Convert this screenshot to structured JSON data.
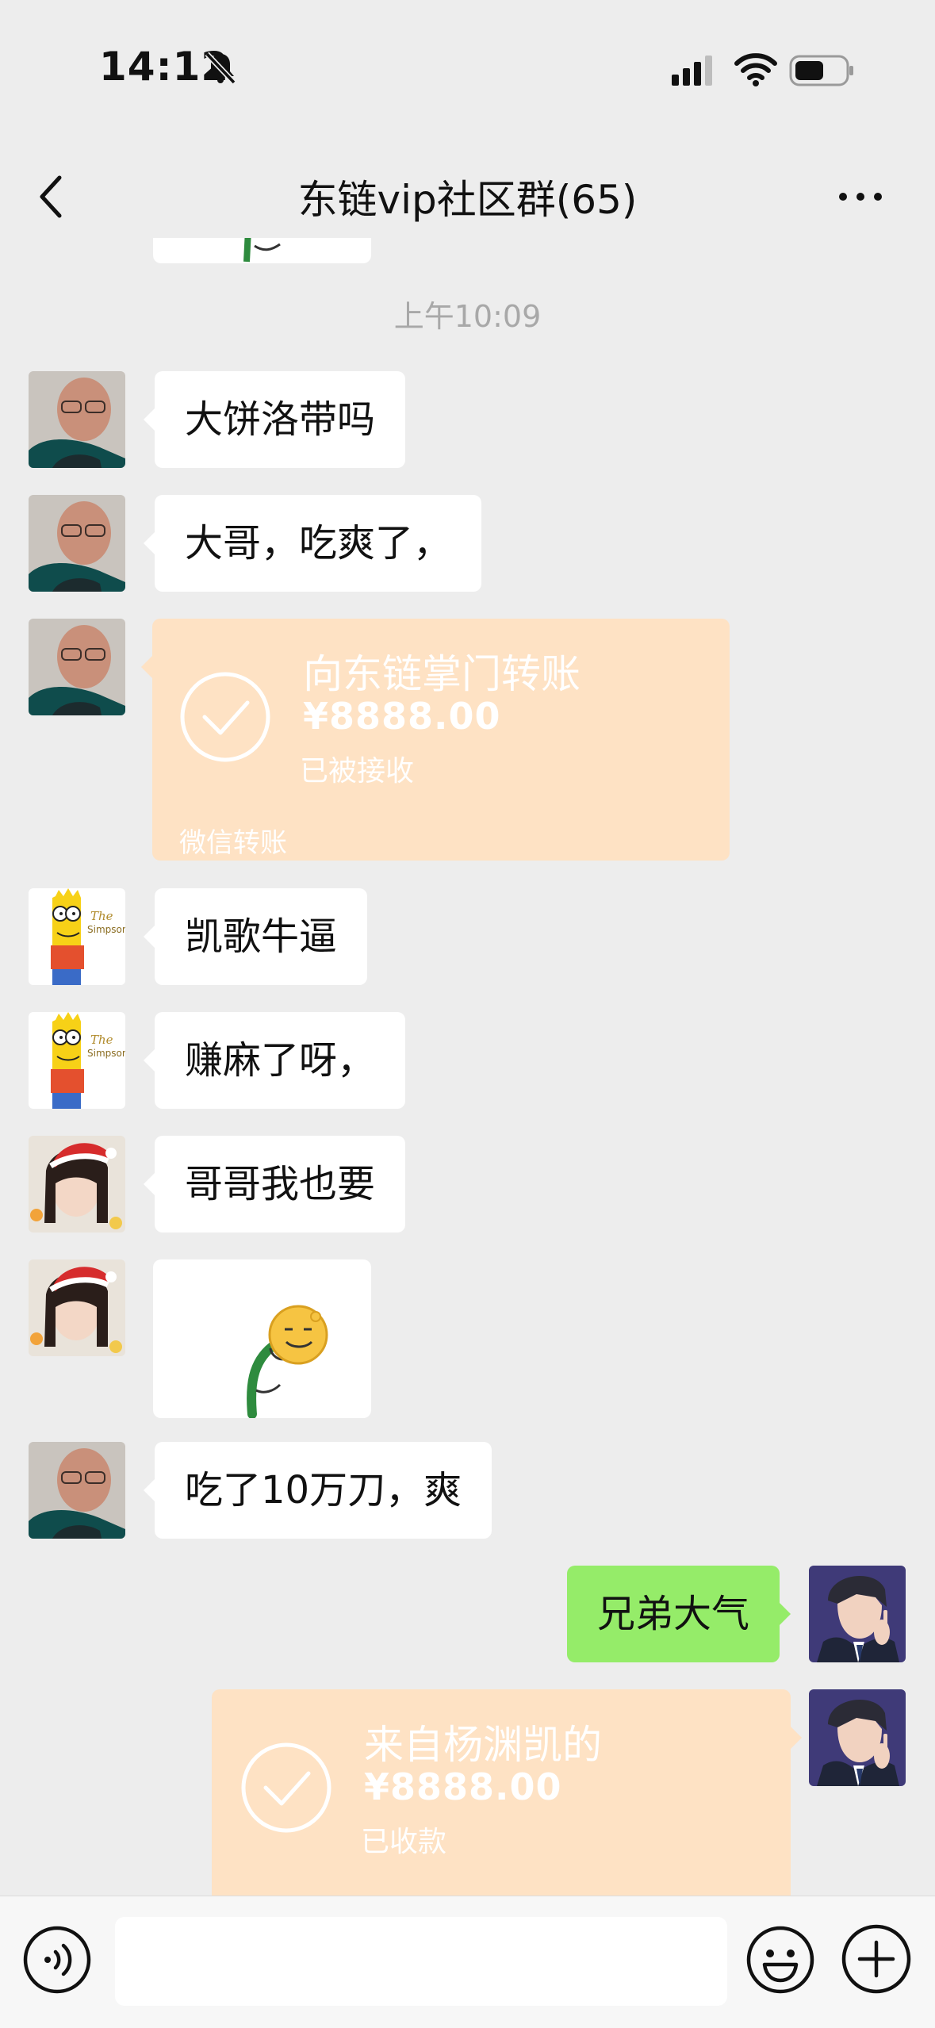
{
  "status_bar": {
    "time": "14:12",
    "battery_level": 0.55
  },
  "header": {
    "title": "东链vip社区群(65)"
  },
  "chat": {
    "timestamp": "上午10:09",
    "messages": [
      {
        "side": "left",
        "avatar": "man-glasses-avatar",
        "text": "大饼洛带吗"
      },
      {
        "side": "left",
        "avatar": "man-glasses-avatar",
        "text": "大哥，吃爽了，"
      },
      {
        "side": "left",
        "avatar": "man-glasses-avatar",
        "type": "transfer",
        "title": "向东链掌门转账",
        "amount": "¥8888.00",
        "status": "已被接收",
        "footer": "微信转账"
      },
      {
        "side": "left",
        "avatar": "bart-simpson-avatar",
        "text": "凯歌牛逼"
      },
      {
        "side": "left",
        "avatar": "bart-simpson-avatar",
        "text": "赚麻了呀，"
      },
      {
        "side": "left",
        "avatar": "woman-santa-hat-avatar",
        "text": "哥哥我也要"
      },
      {
        "side": "left",
        "avatar": "woman-santa-hat-avatar",
        "type": "sticker"
      },
      {
        "side": "left",
        "avatar": "man-glasses-avatar",
        "text": "吃了10万刀，爽"
      },
      {
        "side": "right",
        "avatar": "anime-man-avatar",
        "text": "兄弟大气"
      },
      {
        "side": "right",
        "avatar": "anime-man-avatar",
        "type": "transfer",
        "title": "来自杨渊凯的",
        "amount": "¥8888.00",
        "status": "已收款"
      }
    ]
  },
  "colors": {
    "background": "#EDEDED",
    "bubble_right": "#95EC69",
    "transfer": "#FEE2C4",
    "timestamp": "#A8A8A8"
  }
}
